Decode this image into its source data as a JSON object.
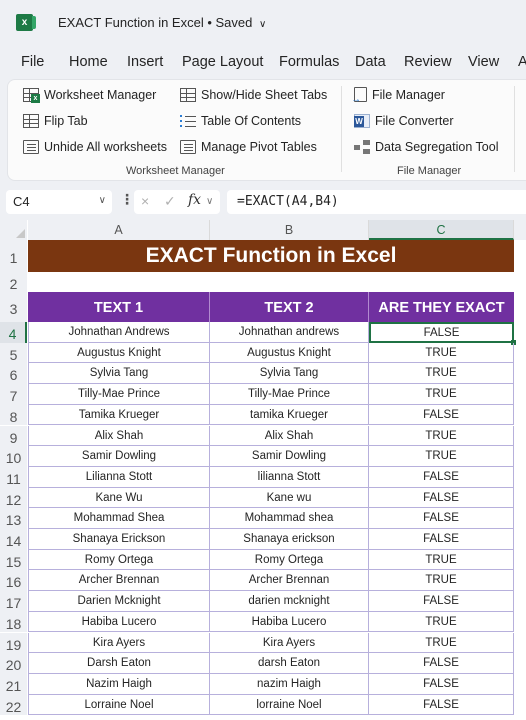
{
  "window": {
    "app_icon": "excel-logo-icon",
    "title": "EXACT Function in Excel",
    "status": "Saved"
  },
  "menu_tabs": [
    "File",
    "Home",
    "Insert",
    "Page Layout",
    "Formulas",
    "Data",
    "Review",
    "View",
    "A"
  ],
  "ribbon": {
    "groups": [
      {
        "label": "Worksheet Manager",
        "items": [
          {
            "label": "Worksheet Manager",
            "icon": "worksheet-manager-icon"
          },
          {
            "label": "Flip Tab",
            "icon": "flip-tab-icon"
          },
          {
            "label": "Unhide All worksheets",
            "icon": "unhide-worksheets-icon"
          },
          {
            "label": "Show/Hide Sheet Tabs",
            "icon": "show-hide-tabs-icon"
          },
          {
            "label": "Table Of Contents",
            "icon": "table-of-contents-icon"
          },
          {
            "label": "Manage Pivot Tables",
            "icon": "pivot-tables-icon"
          }
        ]
      },
      {
        "label": "File Manager",
        "items": [
          {
            "label": "File Manager",
            "icon": "file-manager-icon"
          },
          {
            "label": "File Converter",
            "icon": "word-file-converter-icon"
          },
          {
            "label": "Data Segregation Tool",
            "icon": "data-segregation-icon"
          }
        ]
      }
    ]
  },
  "formula_bar": {
    "name_box": "C4",
    "cancel_icon": "×",
    "enter_icon": "✓",
    "fx_label": "fx",
    "formula": "=EXACT(A4,B4)"
  },
  "sheet": {
    "columns": [
      "A",
      "B",
      "C"
    ],
    "selected_column": "C",
    "selected_row": 4,
    "title": "EXACT Function in Excel",
    "headers": [
      "TEXT 1",
      "TEXT 2",
      "ARE THEY EXACT"
    ],
    "row_numbers": [
      1,
      2,
      3,
      4,
      5,
      6,
      7,
      8,
      9,
      10,
      11,
      12,
      13,
      14,
      15,
      16,
      17,
      18,
      19,
      20,
      21,
      22
    ],
    "rows": [
      {
        "row": 4,
        "text1": "Johnathan Andrews",
        "text2": "Johnathan andrews",
        "exact": "FALSE"
      },
      {
        "row": 5,
        "text1": "Augustus Knight",
        "text2": "Augustus Knight",
        "exact": "TRUE"
      },
      {
        "row": 6,
        "text1": "Sylvia Tang",
        "text2": "Sylvia Tang",
        "exact": "TRUE"
      },
      {
        "row": 7,
        "text1": "Tilly-Mae Prince",
        "text2": "Tilly-Mae Prince",
        "exact": "TRUE"
      },
      {
        "row": 8,
        "text1": "Tamika Krueger",
        "text2": "tamika Krueger",
        "exact": "FALSE"
      },
      {
        "row": 9,
        "text1": "Alix Shah",
        "text2": "Alix Shah",
        "exact": "TRUE"
      },
      {
        "row": 10,
        "text1": "Samir Dowling",
        "text2": "Samir Dowling",
        "exact": "TRUE"
      },
      {
        "row": 11,
        "text1": "Lilianna Stott",
        "text2": "lilianna Stott",
        "exact": "FALSE"
      },
      {
        "row": 12,
        "text1": "Kane Wu",
        "text2": "Kane wu",
        "exact": "FALSE"
      },
      {
        "row": 13,
        "text1": "Mohammad Shea",
        "text2": "Mohammad shea",
        "exact": "FALSE"
      },
      {
        "row": 14,
        "text1": "Shanaya Erickson",
        "text2": "Shanaya erickson",
        "exact": "FALSE"
      },
      {
        "row": 15,
        "text1": "Romy Ortega",
        "text2": "Romy Ortega",
        "exact": "TRUE"
      },
      {
        "row": 16,
        "text1": "Archer Brennan",
        "text2": "Archer Brennan",
        "exact": "TRUE"
      },
      {
        "row": 17,
        "text1": "Darien Mcknight",
        "text2": "darien mcknight",
        "exact": "FALSE"
      },
      {
        "row": 18,
        "text1": "Habiba Lucero",
        "text2": "Habiba Lucero",
        "exact": "TRUE"
      },
      {
        "row": 19,
        "text1": "Kira Ayers",
        "text2": "Kira Ayers",
        "exact": "TRUE"
      },
      {
        "row": 20,
        "text1": "Darsh Eaton",
        "text2": "darsh Eaton",
        "exact": "FALSE"
      },
      {
        "row": 21,
        "text1": "Nazim Haigh",
        "text2": "nazim Haigh",
        "exact": "FALSE"
      },
      {
        "row": 22,
        "text1": "Lorraine Noel",
        "text2": "lorraine Noel",
        "exact": "FALSE"
      }
    ]
  },
  "colors": {
    "title_fill": "#7a3610",
    "header_fill": "#7030a0",
    "selection": "#1f7244",
    "excel_green": "#1d7a45"
  }
}
